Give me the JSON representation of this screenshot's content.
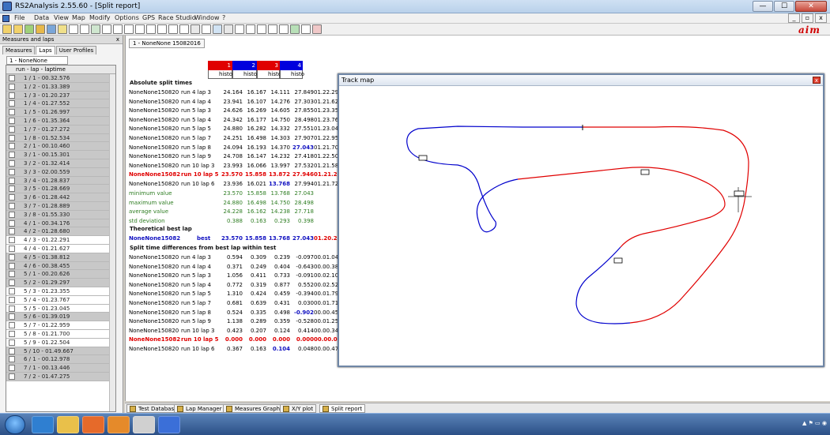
{
  "window": {
    "title": "RS2Analysis 2.55.60 - [Split report]"
  },
  "menu": [
    "File",
    "Data",
    "View",
    "Map",
    "Modify",
    "Options",
    "GPS",
    "Race Studio",
    "Window",
    "?"
  ],
  "aim_logo": "aim",
  "left_panel": {
    "title": "Measures and laps",
    "close_label": "x",
    "tabs": [
      "Measures",
      "Laps",
      "User Profiles"
    ],
    "active_tab": "Laps",
    "subtab": "1 - NoneNone 15082016",
    "list_header": "run - lap - laptime",
    "laps": [
      {
        "label": "1 / 1 - 00.32.576",
        "shade": true
      },
      {
        "label": "1 / 2 - 01.33.389",
        "shade": true
      },
      {
        "label": "1 / 3 - 01.20.237",
        "shade": true
      },
      {
        "label": "1 / 4 - 01.27.552",
        "shade": true
      },
      {
        "label": "1 / 5 - 01.26.997",
        "shade": true
      },
      {
        "label": "1 / 6 - 01.35.364",
        "shade": true
      },
      {
        "label": "1 / 7 - 01.27.272",
        "shade": true
      },
      {
        "label": "1 / 8 - 01.52.534",
        "shade": true
      },
      {
        "label": "2 / 1 - 00.10.460",
        "shade": true
      },
      {
        "label": "3 / 1 - 00.15.301",
        "shade": true
      },
      {
        "label": "3 / 2 - 01.32.414",
        "shade": true
      },
      {
        "label": "3 / 3 - 02.00.559",
        "shade": true
      },
      {
        "label": "3 / 4 - 01.28.837",
        "shade": true
      },
      {
        "label": "3 / 5 - 01.28.669",
        "shade": true
      },
      {
        "label": "3 / 6 - 01.28.442",
        "shade": true
      },
      {
        "label": "3 / 7 - 01.28.889",
        "shade": true
      },
      {
        "label": "3 / 8 - 01.55.330",
        "shade": true
      },
      {
        "label": "4 / 1 - 00.34.176",
        "shade": true
      },
      {
        "label": "4 / 2 - 01.28.680",
        "shade": true
      },
      {
        "label": "4 / 3 - 01.22.291",
        "shade": false
      },
      {
        "label": "4 / 4 - 01.21.627",
        "shade": false
      },
      {
        "label": "4 / 5 - 01.38.812",
        "shade": true
      },
      {
        "label": "4 / 6 - 00.38.455",
        "shade": true
      },
      {
        "label": "5 / 1 - 00.20.626",
        "shade": true
      },
      {
        "label": "5 / 2 - 01.29.297",
        "shade": true
      },
      {
        "label": "5 / 3 - 01.23.355",
        "shade": false
      },
      {
        "label": "5 / 4 - 01.23.767",
        "shade": false
      },
      {
        "label": "5 / 5 - 01.23.045",
        "shade": false
      },
      {
        "label": "5 / 6 - 01.39.019",
        "shade": true
      },
      {
        "label": "5 / 7 - 01.22.959",
        "shade": false
      },
      {
        "label": "5 / 8 - 01.21.700",
        "shade": false
      },
      {
        "label": "5 / 9 - 01.22.504",
        "shade": false
      },
      {
        "label": "5 / 10 - 01.49.667",
        "shade": true
      },
      {
        "label": "6 / 1 - 00.12.978",
        "shade": true
      },
      {
        "label": "7 / 1 - 00.13.446",
        "shade": true
      },
      {
        "label": "7 / 2 - 01.47.275",
        "shade": true
      }
    ]
  },
  "report": {
    "tab_label": "1 - NoneNone 15082016",
    "columns": [
      {
        "num": "1",
        "color": "red",
        "sub": "histo"
      },
      {
        "num": "2",
        "color": "blue",
        "sub": "histo"
      },
      {
        "num": "3",
        "color": "red",
        "sub": "histo"
      },
      {
        "num": "4",
        "color": "blue",
        "sub": "histo"
      }
    ],
    "sections": {
      "absolute": "Absolute split times",
      "theoretical": "Theoretical best lap",
      "differences": "Split time differences from best lap within test"
    },
    "absolute_rows": [
      {
        "name": "NoneNone150820",
        "lap": "run 4 lap 3",
        "s1": "24.164",
        "s2": "16.167",
        "s3": "14.111",
        "s4": "27.849",
        "total": "01.22.291",
        "style": "normal"
      },
      {
        "name": "NoneNone150820",
        "lap": "run 4 lap 4",
        "s1": "23.941",
        "s2": "16.107",
        "s3": "14.276",
        "s4": "27.303",
        "total": "01.21.627",
        "style": "normal"
      },
      {
        "name": "NoneNone150820",
        "lap": "run 5 lap 3",
        "s1": "24.626",
        "s2": "16.269",
        "s3": "14.605",
        "s4": "27.855",
        "total": "01.23.355",
        "style": "normal"
      },
      {
        "name": "NoneNone150820",
        "lap": "run 5 lap 4",
        "s1": "24.342",
        "s2": "16.177",
        "s3": "14.750",
        "s4": "28.498",
        "total": "01.23.767",
        "style": "normal"
      },
      {
        "name": "NoneNone150820",
        "lap": "run 5 lap 5",
        "s1": "24.880",
        "s2": "16.282",
        "s3": "14.332",
        "s4": "27.551",
        "total": "01.23.045",
        "style": "normal"
      },
      {
        "name": "NoneNone150820",
        "lap": "run 5 lap 7",
        "s1": "24.251",
        "s2": "16.498",
        "s3": "14.303",
        "s4": "27.907",
        "total": "01.22.959",
        "style": "normal"
      },
      {
        "name": "NoneNone150820",
        "lap": "run 5 lap 8",
        "s1": "24.094",
        "s2": "16.193",
        "s3": "14.370",
        "s4": "27.043",
        "total": "01.21.700",
        "style": "normal",
        "bold4": true
      },
      {
        "name": "NoneNone150820",
        "lap": "run 5 lap 9",
        "s1": "24.708",
        "s2": "16.147",
        "s3": "14.232",
        "s4": "27.418",
        "total": "01.22.504",
        "style": "normal"
      },
      {
        "name": "NoneNone150820",
        "lap": "run 10 lap 3",
        "s1": "23.993",
        "s2": "16.066",
        "s3": "13.997",
        "s4": "27.532",
        "total": "01.21.587",
        "style": "normal"
      },
      {
        "name": "NoneNone15082",
        "lap": "run 10 lap 5",
        "s1": "23.570",
        "s2": "15.858",
        "s3": "13.872",
        "s4": "27.946",
        "total": "01.21.246",
        "style": "red"
      },
      {
        "name": "NoneNone150820",
        "lap": "run 10 lap 6",
        "s1": "23.936",
        "s2": "16.021",
        "s3": "13.768",
        "s4": "27.994",
        "total": "01.21.720",
        "style": "normal",
        "bold3": true
      }
    ],
    "stats_rows": [
      {
        "name": "minimum value",
        "s1": "23.570",
        "s2": "15.858",
        "s3": "13.768",
        "s4": "27.043"
      },
      {
        "name": "maximum value",
        "s1": "24.880",
        "s2": "16.498",
        "s3": "14.750",
        "s4": "28.498"
      },
      {
        "name": "average value",
        "s1": "24.228",
        "s2": "16.162",
        "s3": "14.238",
        "s4": "27.718"
      },
      {
        "name": "std deviation",
        "s1": "0.388",
        "s2": "0.163",
        "s3": "0.293",
        "s4": "0.398"
      }
    ],
    "best_row": {
      "name": "NoneNone15082",
      "lap": "best",
      "s1": "23.570",
      "s2": "15.858",
      "s3": "13.768",
      "s4": "27.043",
      "total": "01.20.239"
    },
    "diff_rows": [
      {
        "name": "NoneNone150820",
        "lap": "run 4 lap 3",
        "s1": "0.594",
        "s2": "0.309",
        "s3": "0.239",
        "s4": "-0.097",
        "total": "00.01.045",
        "style": "normal"
      },
      {
        "name": "NoneNone150820",
        "lap": "run 4 lap 4",
        "s1": "0.371",
        "s2": "0.249",
        "s3": "0.404",
        "s4": "-0.643",
        "total": "00.00.381",
        "style": "normal"
      },
      {
        "name": "NoneNone150820",
        "lap": "run 5 lap 3",
        "s1": "1.056",
        "s2": "0.411",
        "s3": "0.733",
        "s4": "-0.091",
        "total": "00.02.109",
        "style": "normal"
      },
      {
        "name": "NoneNone150820",
        "lap": "run 5 lap 4",
        "s1": "0.772",
        "s2": "0.319",
        "s3": "0.877",
        "s4": "0.552",
        "total": "00.02.521",
        "style": "normal"
      },
      {
        "name": "NoneNone150820",
        "lap": "run 5 lap 5",
        "s1": "1.310",
        "s2": "0.424",
        "s3": "0.459",
        "s4": "-0.394",
        "total": "00.01.799",
        "style": "normal"
      },
      {
        "name": "NoneNone150820",
        "lap": "run 5 lap 7",
        "s1": "0.681",
        "s2": "0.639",
        "s3": "0.431",
        "s4": "0.030",
        "total": "00.01.713",
        "style": "normal"
      },
      {
        "name": "NoneNone150820",
        "lap": "run 5 lap 8",
        "s1": "0.524",
        "s2": "0.335",
        "s3": "0.498",
        "s4": "-0.902",
        "total": "00.00.454",
        "style": "normal",
        "bold4": true
      },
      {
        "name": "NoneNone150820",
        "lap": "run 5 lap 9",
        "s1": "1.138",
        "s2": "0.289",
        "s3": "0.359",
        "s4": "-0.528",
        "total": "00.01.258",
        "style": "normal"
      },
      {
        "name": "NoneNone150820",
        "lap": "run 10 lap 3",
        "s1": "0.423",
        "s2": "0.207",
        "s3": "0.124",
        "s4": "0.414",
        "total": "00.00.341",
        "style": "normal"
      },
      {
        "name": "NoneNone15082",
        "lap": "run 10 lap 5",
        "s1": "0.000",
        "s2": "0.000",
        "s3": "0.000",
        "s4": "0.000",
        "total": "00.00.000",
        "style": "red"
      },
      {
        "name": "NoneNone150820",
        "lap": "run 10 lap 6",
        "s1": "0.367",
        "s2": "0.163",
        "s3": "0.104",
        "s4": "0.048",
        "total": "00.00.474",
        "style": "normal",
        "bold3": true
      }
    ]
  },
  "track_map": {
    "title": "Track map",
    "close_label": "x",
    "colors": {
      "red": "#e00000",
      "blue": "#0000cc"
    }
  },
  "bottom_tabs": [
    "Test Database",
    "Lap Manager",
    "Measures Graph",
    "X/Y plot",
    "Split report"
  ],
  "bottom_tab_active": "Split report",
  "colors": {
    "best_red": "#e00000",
    "stats_green": "#2e7d22",
    "best_blue": "#1010c0"
  }
}
